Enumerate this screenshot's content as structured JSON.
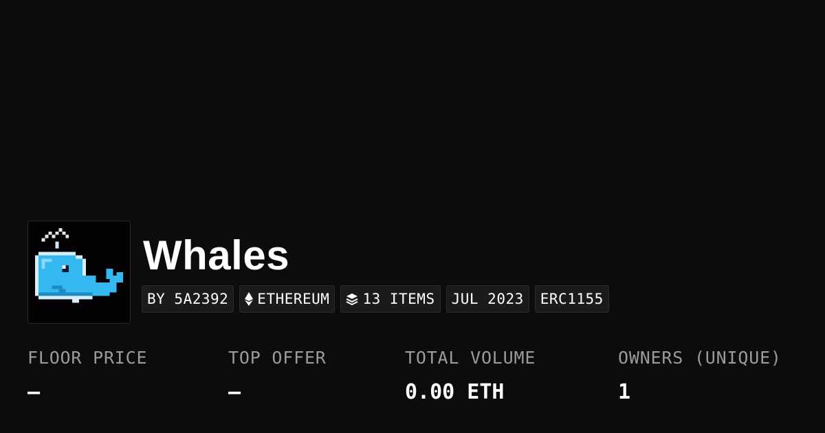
{
  "collection": {
    "name": "Whales",
    "avatar_icon": "pixel-whale-icon",
    "tags": [
      {
        "label": "BY 5A2392",
        "icon": ""
      },
      {
        "label": "ETHEREUM",
        "icon": "ethereum-icon"
      },
      {
        "label": "13 ITEMS",
        "icon": "layers-icon"
      },
      {
        "label": "JUL 2023",
        "icon": ""
      },
      {
        "label": "ERC1155",
        "icon": ""
      }
    ]
  },
  "stats": [
    {
      "label": "FLOOR PRICE",
      "value": "–"
    },
    {
      "label": "TOP OFFER",
      "value": "–"
    },
    {
      "label": "TOTAL VOLUME",
      "value": "0.00 ETH"
    },
    {
      "label": "OWNERS (UNIQUE)",
      "value": "1"
    }
  ],
  "colors": {
    "background": "#0c0c0d",
    "whale": "#33b8f0",
    "tag_background": "#1b1b1c",
    "label_gray": "#9b9b9b"
  }
}
